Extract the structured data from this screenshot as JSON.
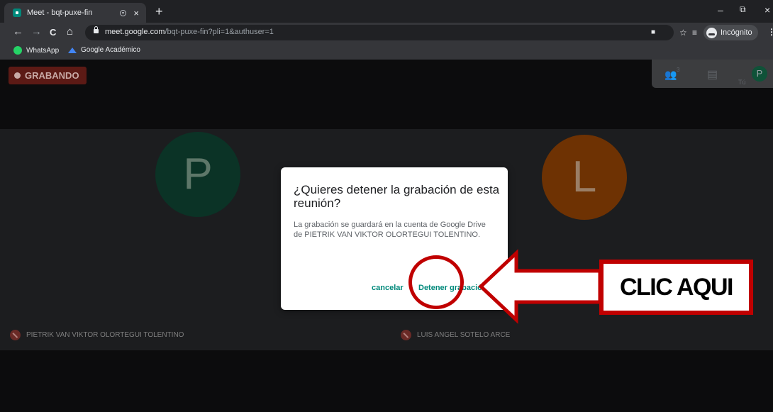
{
  "browser": {
    "tab_title": "Meet - bqt-puxe-fin",
    "tab_close": "×",
    "new_tab": "+",
    "minimize": "–",
    "restore": "⧉",
    "close": "×",
    "url_domain": "meet.google.com",
    "url_path": "/bqt-puxe-fin?pli=1&authuser=1",
    "incognito_label": "Incógnito",
    "bookmarks": [
      {
        "label": "WhatsApp",
        "icon": "whatsapp-icon"
      },
      {
        "label": "Google Académico",
        "icon": "google-scholar-icon"
      }
    ]
  },
  "meet": {
    "recording_badge": "GRABANDO",
    "participants_count": "3",
    "self_label": "Tú",
    "self_initial": "P",
    "participants": [
      {
        "initial": "P",
        "name": "PIETRIK VAN VIKTOR OLORTEGUI TOLENTINO",
        "color": "#0b3326"
      },
      {
        "initial": "L",
        "name": "LUIS ANGEL SOTELO ARCE",
        "color": "#6e3203"
      }
    ]
  },
  "dialog": {
    "title": "¿Quieres detener la grabación de esta reunión?",
    "body": "La grabación se guardará en la cuenta de Google Drive de PIETRIK VAN VIKTOR OLORTEGUI TOLENTINO.",
    "cancel_label": "cancelar",
    "confirm_label": "Detener grabación"
  },
  "annotation": {
    "callout_text": "CLIC AQUI",
    "color": "#c00000"
  }
}
